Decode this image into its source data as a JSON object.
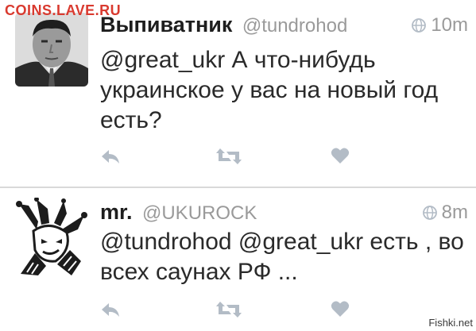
{
  "watermark_top": "COINS.LAVE.RU",
  "watermark_bottom": "Fishki.net",
  "tweets": [
    {
      "name": "Выпиватник",
      "handle": "@tundrohod",
      "time": "10m",
      "text": "@great_ukr А что-нибудь украинское у вас на новый год есть?",
      "actions": [
        "reply-icon",
        "retweet-icon",
        "like-icon"
      ]
    },
    {
      "name": "mr.",
      "handle": "@UKUROCK",
      "time": "8m",
      "text": "@tundrohod @great_ukr есть , во всех саунах РФ ...",
      "actions": [
        "reply-icon",
        "retweet-icon",
        "like-icon"
      ]
    }
  ],
  "colors": {
    "icon_gray": "#b3bcc6",
    "meta_gray": "#9a9a9a",
    "watermark_red": "#d93a2f"
  }
}
